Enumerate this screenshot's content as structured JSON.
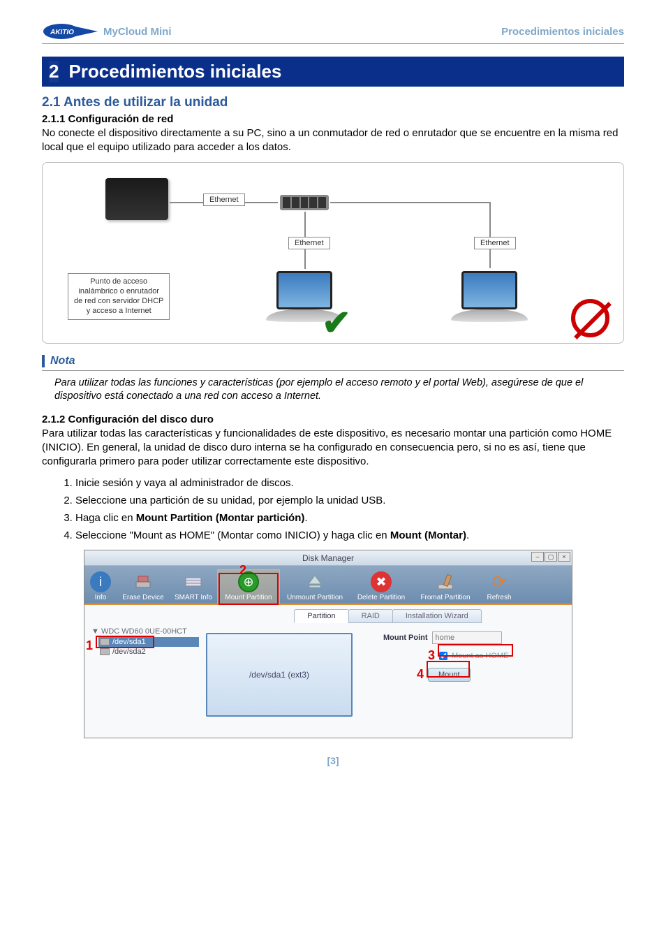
{
  "header": {
    "product": "MyCloud Mini",
    "section": "Procedimientos iniciales",
    "logo_text": "AKITIO"
  },
  "chapter": {
    "number": "2",
    "title": "Procedimientos iniciales"
  },
  "s21": {
    "heading": "2.1  Antes de utilizar la unidad",
    "s211_heading": "2.1.1   Configuración de red",
    "s211_body": "No conecte el dispositivo directamente a su PC, sino a un conmutador de red o enrutador que se encuentre en la misma red local que el equipo utilizado para acceder a los datos.",
    "s212_heading": "2.1.2   Configuración del disco duro",
    "s212_body": "Para utilizar todas las características y funcionalidades de este dispositivo, es necesario montar una partición como HOME (INICIO). En general, la unidad de disco duro interna se ha configurado en consecuencia pero, si no es así, tiene que configurarla primero para poder utilizar correctamente este dispositivo."
  },
  "diagram": {
    "ethernet": "Ethernet",
    "router_box": "Punto de acceso\ninalámbrico o enrutador\nde red con servidor DHCP\ny acceso a Internet"
  },
  "nota": {
    "label": "Nota",
    "text": "Para utilizar todas las funciones y características (por ejemplo el acceso remoto y el portal Web), asegúrese de que el dispositivo está conectado a una red con acceso a Internet."
  },
  "steps": {
    "s1": "Inicie sesión y vaya al administrador de discos.",
    "s2": "Seleccione una partición de su unidad, por ejemplo la unidad USB.",
    "s3_a": "Haga clic en ",
    "s3_b": "Mount Partition (Montar partición)",
    "s3_c": ".",
    "s4_a": "Seleccione \"Mount as HOME\" (Montar como INICIO) y haga clic en ",
    "s4_b": "Mount (Montar)",
    "s4_c": "."
  },
  "screenshot": {
    "title": "Disk Manager",
    "toolbar": {
      "info": "Info",
      "erase": "Erase Device",
      "smart": "SMART Info",
      "mount": "Mount Partition",
      "unmount": "Unmount Partition",
      "delete": "Delete Partition",
      "format": "Fromat Partition",
      "refresh": "Refresh"
    },
    "tabs": {
      "partition": "Partition",
      "raid": "RAID",
      "wizard": "Installation Wizard"
    },
    "tree": {
      "root": "WDC WD60 0UE-00HCT",
      "item1": "/dev/sda1",
      "item2": "/dev/sda2"
    },
    "partition_label": "/dev/sda1 (ext3)",
    "mount": {
      "label": "Mount Point",
      "placeholder": "home",
      "checkbox": "Mount as HOME",
      "button": "Mount"
    },
    "callouts": {
      "n1": "1",
      "n2": "2",
      "n3": "3",
      "n4": "4"
    }
  },
  "page_number": "[3]"
}
